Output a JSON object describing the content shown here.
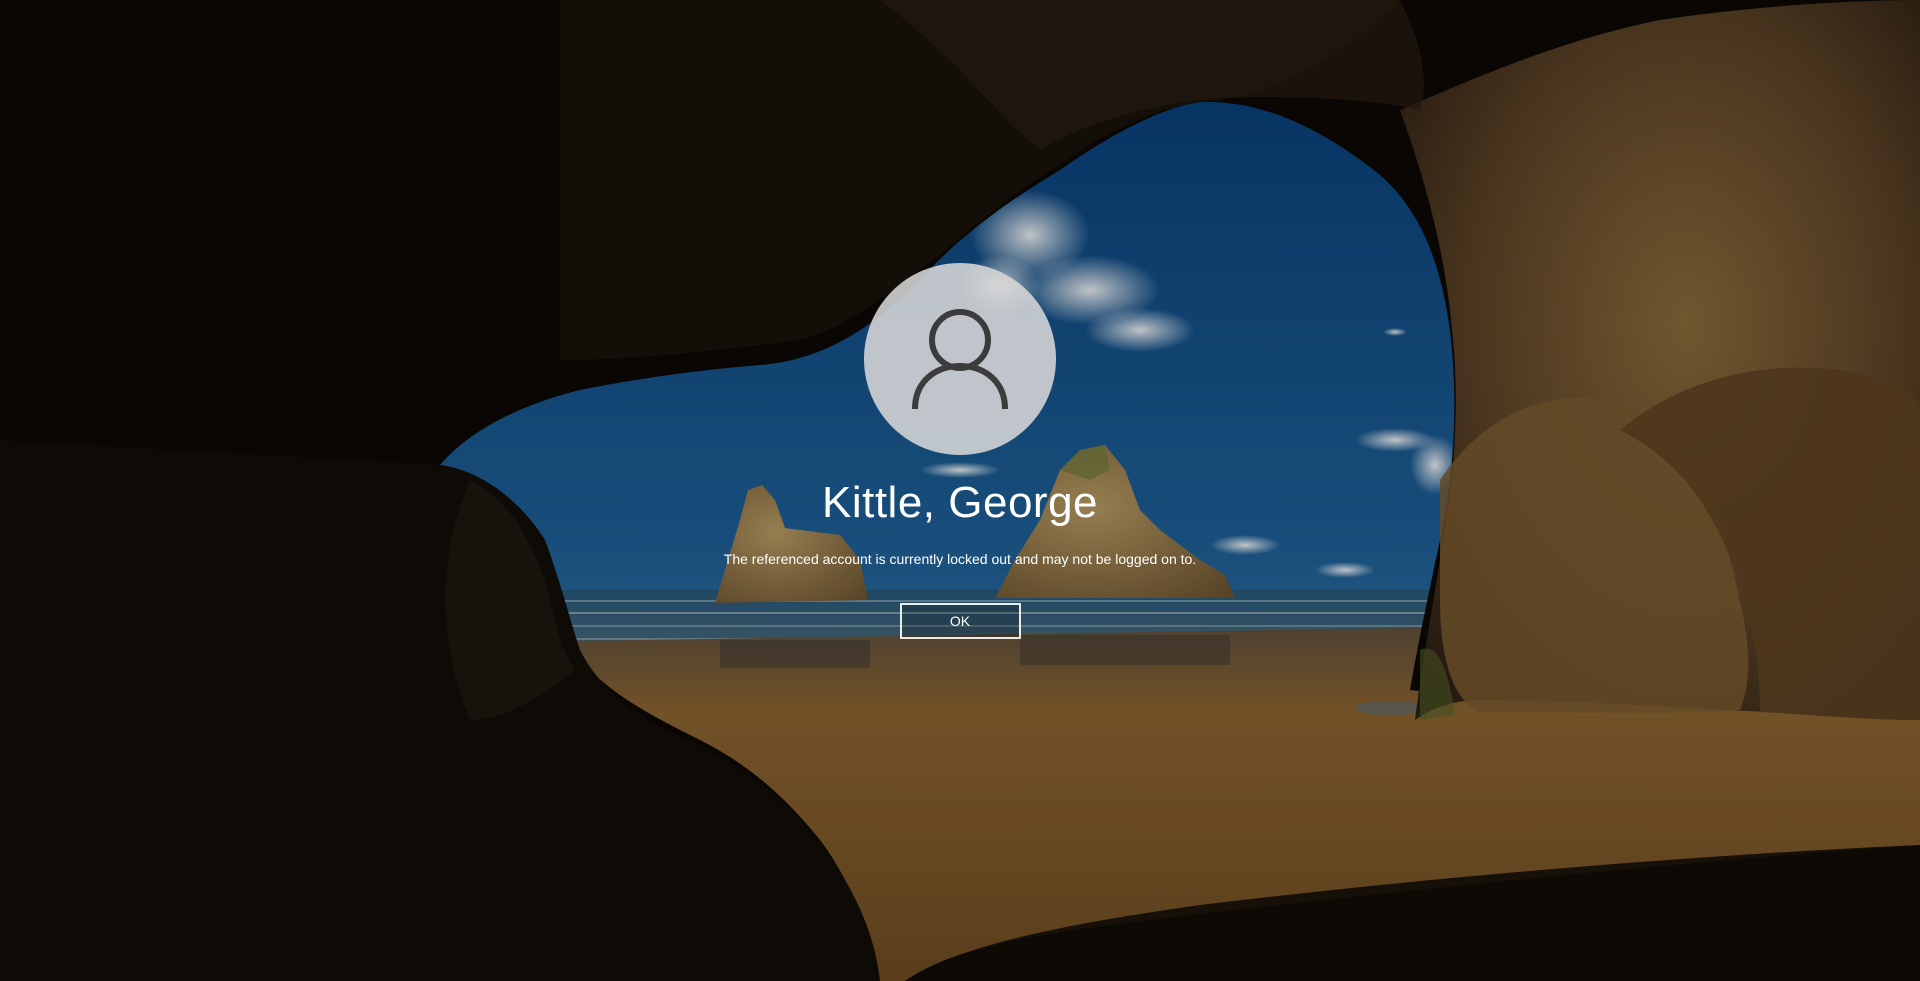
{
  "lock_screen": {
    "user_name": "Kittle, George",
    "message": "The referenced account is currently locked out and may not be logged on to.",
    "ok_label": "OK",
    "avatar_icon": "user-silhouette-icon"
  },
  "colors": {
    "text": "#ffffff",
    "avatar_fill": "#d7d7d7",
    "avatar_icon": "#3c3c3c",
    "sky": "#1f5d93",
    "sand": "#7a5427"
  }
}
